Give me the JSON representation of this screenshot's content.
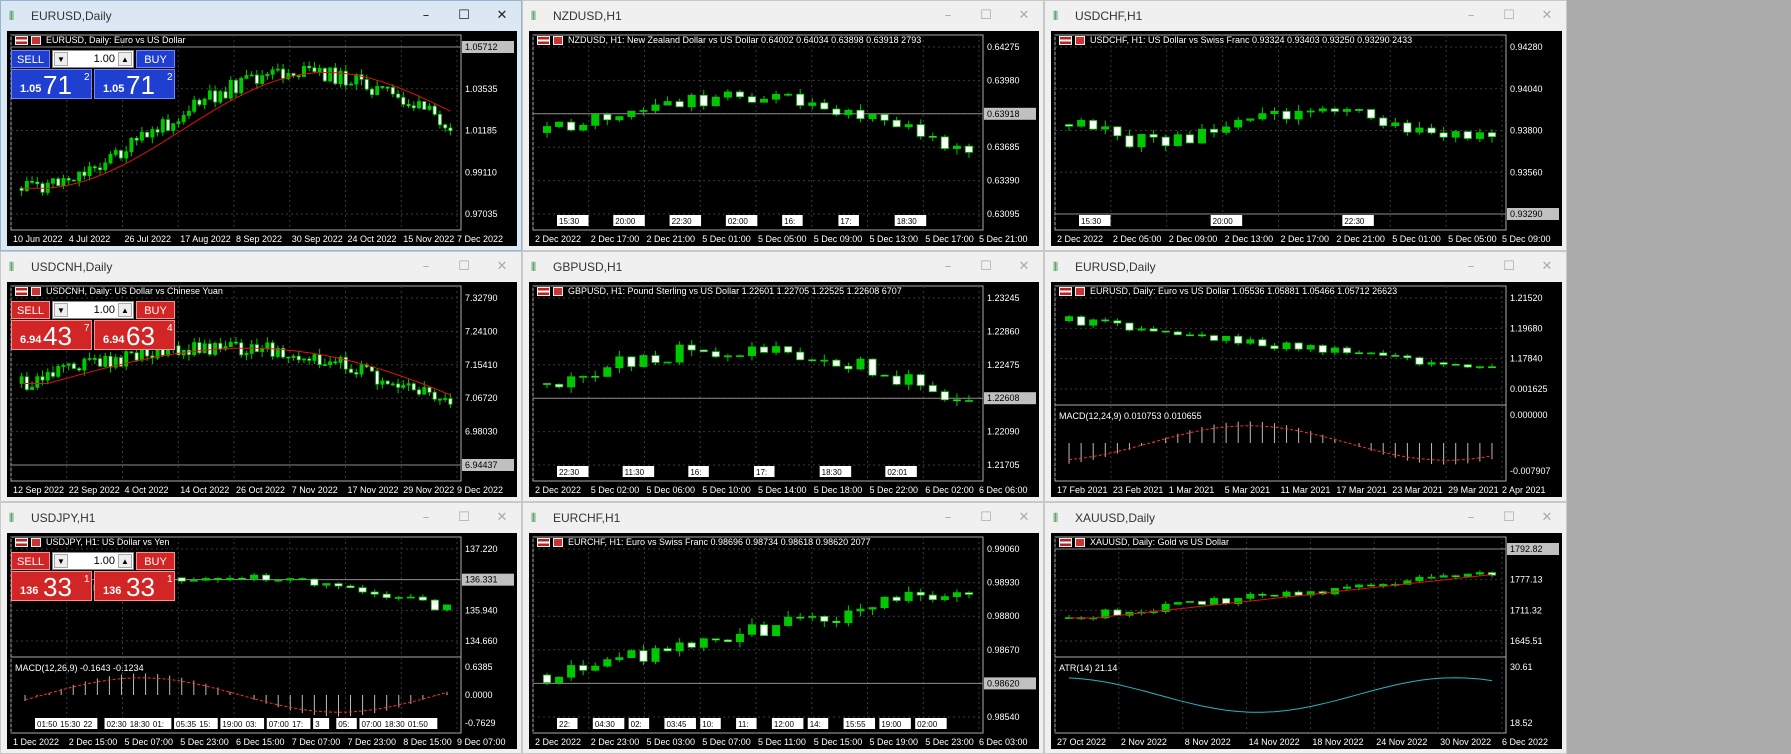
{
  "windows": [
    {
      "title": "EURUSD,Daily",
      "active": true,
      "header": "EURUSD, Daily:  Euro vs US Dollar",
      "trade": {
        "color": "blue",
        "sell": "SELL",
        "buy": "BUY",
        "lot": "1.00",
        "sell_big": "1.05",
        "sell_mid": "71",
        "sell_sup": "2",
        "buy_big": "1.05",
        "buy_mid": "71",
        "buy_sup": "2"
      },
      "price_labels": [
        "1.05712",
        "1.03535",
        "1.01185",
        "0.99110",
        "0.97035"
      ],
      "current": "1.05712",
      "dates": [
        "10 Jun 2022",
        "4 Jul 2022",
        "26 Jul 2022",
        "17 Aug 2022",
        "8 Sep 2022",
        "30 Sep 2022",
        "24 Oct 2022",
        "15 Nov 2022",
        "7 Dec 2022"
      ],
      "markers": [],
      "indicator": null,
      "trend": "v",
      "ma": true
    },
    {
      "title": "NZDUSD,H1",
      "active": false,
      "header": "NZDUSD, H1:  New Zealand Dollar vs US Dollar  0.64002 0.64034 0.63898 0.63918  2793",
      "trade": null,
      "price_labels": [
        "0.64275",
        "0.63980",
        "0.63918",
        "0.63685",
        "0.63390",
        "0.63095"
      ],
      "current": "0.63918",
      "dates": [
        "2 Dec 2022",
        "2 Dec 17:00",
        "2 Dec 21:00",
        "5 Dec 01:00",
        "5 Dec 05:00",
        "5 Dec 09:00",
        "5 Dec 13:00",
        "5 Dec 17:00",
        "5 Dec 21:00"
      ],
      "markers": [
        "15:30",
        "20:00",
        "22:30",
        "02:00",
        "16:",
        "17:",
        "18:30"
      ],
      "indicator": null,
      "trend": "hump",
      "ma": false
    },
    {
      "title": "USDCHF,H1",
      "active": false,
      "header": "USDCHF, H1:  US Dollar vs Swiss Franc  0.93324 0.93403 0.93250 0.93290  2433",
      "trade": null,
      "price_labels": [
        "0.94280",
        "0.94040",
        "0.93800",
        "0.93560",
        "0.93290"
      ],
      "current": "0.93290",
      "dates": [
        "2 Dec 2022",
        "2 Dec 05:00",
        "2 Dec 09:00",
        "2 Dec 13:00",
        "2 Dec 17:00",
        "2 Dec 21:00",
        "5 Dec 01:00",
        "5 Dec 05:00",
        "5 Dec 09:00"
      ],
      "markers": [
        "15:30",
        "20:00",
        "22:30"
      ],
      "indicator": null,
      "trend": "flat",
      "ma": false
    },
    {
      "title": "USDCNH,Daily",
      "active": false,
      "header": "USDCNH, Daily:  US Dollar vs Chinese Yuan",
      "trade": {
        "color": "red",
        "sell": "SELL",
        "buy": "BUY",
        "lot": "1.00",
        "sell_big": "6.94",
        "sell_mid": "43",
        "sell_sup": "7",
        "buy_big": "6.94",
        "buy_mid": "63",
        "buy_sup": "4"
      },
      "price_labels": [
        "7.32790",
        "7.24100",
        "7.15410",
        "7.06720",
        "6.98030",
        "6.94437"
      ],
      "current": "6.94437",
      "dates": [
        "12 Sep 2022",
        "22 Sep 2022",
        "4 Oct 2022",
        "14 Oct 2022",
        "26 Oct 2022",
        "7 Nov 2022",
        "17 Nov 2022",
        "29 Nov 2022",
        "9 Dec 2022"
      ],
      "markers": [],
      "indicator": null,
      "trend": "hump",
      "ma": true
    },
    {
      "title": "GBPUSD,H1",
      "active": false,
      "header": "GBPUSD, H1:  Pound Sterling vs US Dollar  1.22601 1.22705 1.22525 1.22608  6707",
      "trade": null,
      "price_labels": [
        "1.23245",
        "1.22860",
        "1.22475",
        "1.22608",
        "1.22090",
        "1.21705"
      ],
      "current": "1.22608",
      "dates": [
        "2 Dec 2022",
        "5 Dec 02:00",
        "5 Dec 06:00",
        "5 Dec 10:00",
        "5 Dec 14:00",
        "5 Dec 18:00",
        "5 Dec 22:00",
        "6 Dec 02:00",
        "6 Dec 06:00"
      ],
      "markers": [
        "22:30",
        "11:30",
        "16:",
        "17:",
        "18:30",
        "02:01"
      ],
      "indicator": null,
      "trend": "hump",
      "ma": false
    },
    {
      "title": "EURUSD,Daily",
      "active": false,
      "header": "EURUSD, Daily:  Euro vs US Dollar  1.05536 1.05881 1.05466 1.05712  26623",
      "trade": null,
      "price_labels": [
        "1.21520",
        "1.19680",
        "1.17840",
        "0.001625"
      ],
      "current": "",
      "dates": [
        "17 Feb 2021",
        "23 Feb 2021",
        "1 Mar 2021",
        "5 Mar 2021",
        "11 Mar 2021",
        "17 Mar 2021",
        "23 Mar 2021",
        "29 Mar 2021",
        "2 Apr 2021"
      ],
      "markers": [],
      "indicator": {
        "label": "MACD(12,24,9)  0.010753  0.010655",
        "levels": [
          "0.000000",
          "-0.007907"
        ]
      },
      "trend": "down",
      "ma": false
    },
    {
      "title": "USDJPY,H1",
      "active": false,
      "header": "USDJPY, H1:  US Dollar vs Yen",
      "trade": {
        "color": "red",
        "sell": "SELL",
        "buy": "BUY",
        "lot": "1.00",
        "sell_big": "136",
        "sell_mid": "33",
        "sell_sup": "1",
        "buy_big": "136",
        "buy_mid": "33",
        "buy_sup": "1"
      },
      "price_labels": [
        "137.220",
        "136.331",
        "135.940",
        "134.660"
      ],
      "current": "136.331",
      "dates": [
        "1 Dec 2022",
        "2 Dec 15:00",
        "5 Dec 07:00",
        "5 Dec 23:00",
        "6 Dec 15:00",
        "7 Dec 07:00",
        "7 Dec 23:00",
        "8 Dec 15:00",
        "9 Dec 07:00"
      ],
      "markers": [
        "01:50",
        "15:30",
        "22",
        "02:30",
        "18:30",
        "01:",
        "05:35",
        "15:",
        "19:00",
        "03:",
        "07:00",
        "17:",
        "3",
        "05:",
        "07:00",
        "18:30",
        "01:50"
      ],
      "indicator": {
        "label": "MACD(12,26,9)  -0.1643  -0.1234",
        "levels": [
          "0.6385",
          "0.0000",
          "-0.7629"
        ]
      },
      "trend": "hump",
      "ma": false
    },
    {
      "title": "EURCHF,H1",
      "active": false,
      "header": "EURCHF, H1:  Euro vs Swiss Franc  0.98696 0.98734 0.98618 0.98620  2077",
      "trade": null,
      "price_labels": [
        "0.99060",
        "0.98930",
        "0.98800",
        "0.98670",
        "0.98620",
        "0.98540"
      ],
      "current": "0.98620",
      "dates": [
        "2 Dec 2022",
        "2 Dec 23:00",
        "5 Dec 03:00",
        "5 Dec 07:00",
        "5 Dec 11:00",
        "5 Dec 15:00",
        "5 Dec 19:00",
        "5 Dec 23:00",
        "6 Dec 03:00"
      ],
      "markers": [
        "22:",
        "04:30",
        "02:",
        "03:45",
        "10:",
        "11:",
        "12:00",
        "14:",
        "15:55",
        "19:00",
        "02:00"
      ],
      "indicator": null,
      "trend": "up",
      "ma": false
    },
    {
      "title": "XAUUSD,Daily",
      "active": false,
      "header": "XAUUSD, Daily:  Gold vs US Dollar",
      "trade": null,
      "price_labels": [
        "1792.82",
        "1777.13",
        "1711.32",
        "1645.51"
      ],
      "current": "1792.82",
      "dates": [
        "27 Oct 2022",
        "2 Nov 2022",
        "8 Nov 2022",
        "14 Nov 2022",
        "18 Nov 2022",
        "24 Nov 2022",
        "30 Nov 2022",
        "6 Dec 2022"
      ],
      "markers": [],
      "indicator": {
        "label": "ATR(14)  21.14",
        "levels": [
          "30.61",
          "18.52"
        ]
      },
      "trend": "up",
      "ma": true
    }
  ],
  "colors": {
    "bull": "#00c800",
    "bear": "#ffffff",
    "ma": "#e01010",
    "grid": "#3a3a3a",
    "text": "#ffffff",
    "macd": "#ff2b2b",
    "atr": "#20b8c8"
  },
  "icons": {
    "window": "chart-candles-icon",
    "minimize": "minimize-icon",
    "maximize": "maximize-icon",
    "close": "close-icon"
  }
}
